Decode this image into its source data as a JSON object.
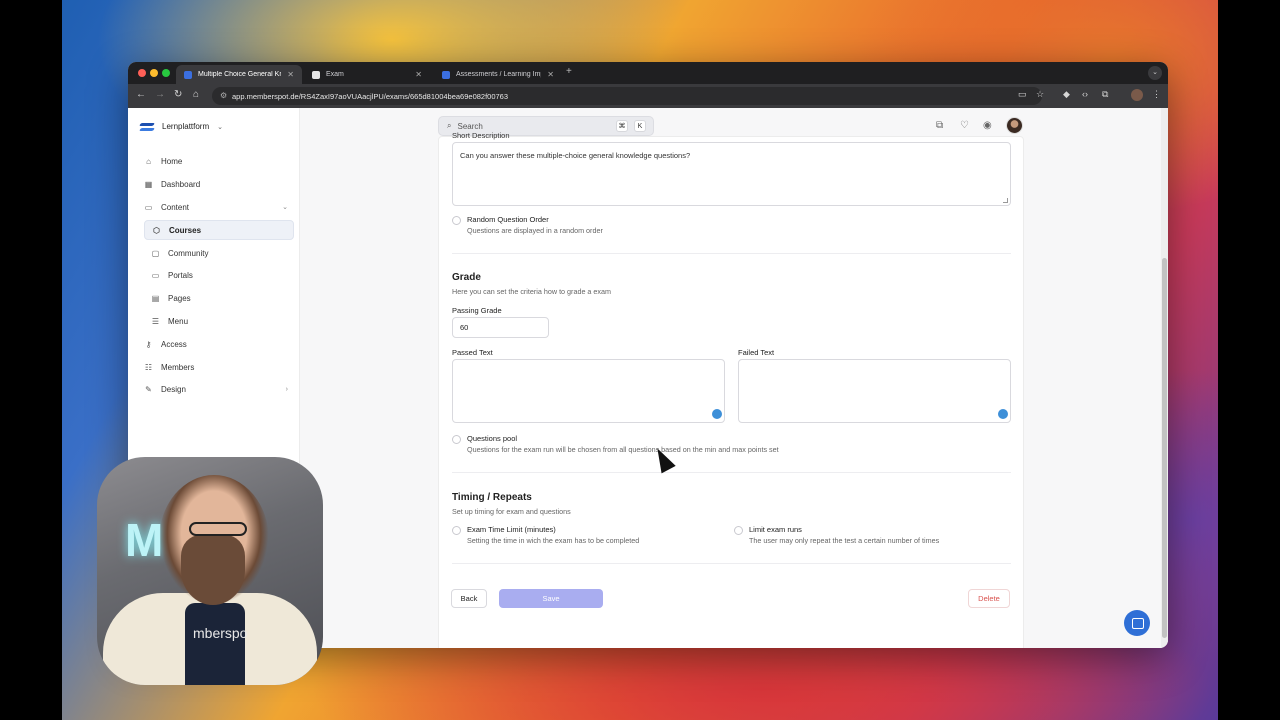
{
  "browser": {
    "tabs": [
      {
        "label": "Multiple Choice General Kno…"
      },
      {
        "label": "Exam"
      },
      {
        "label": "Assessments / Learning Impr…"
      }
    ],
    "url": "app.memberspot.de/RS4ZaxI97aoVUAacjlPU/exams/665d81004bea69e082f00763"
  },
  "sidebar": {
    "brand": "Lernplattform",
    "items": [
      {
        "label": "Home",
        "icon": "home-icon"
      },
      {
        "label": "Dashboard",
        "icon": "dashboard-icon"
      },
      {
        "label": "Content",
        "icon": "folder-icon"
      },
      {
        "label": "Courses",
        "icon": "course-icon"
      },
      {
        "label": "Community",
        "icon": "chat-icon"
      },
      {
        "label": "Portals",
        "icon": "monitor-icon"
      },
      {
        "label": "Pages",
        "icon": "pages-icon"
      },
      {
        "label": "Menu",
        "icon": "menu-icon"
      },
      {
        "label": "Access",
        "icon": "key-icon"
      },
      {
        "label": "Members",
        "icon": "members-icon"
      },
      {
        "label": "Design",
        "icon": "brush-icon"
      }
    ]
  },
  "topbar": {
    "search_placeholder": "Search",
    "shortcut_cmd": "⌘",
    "shortcut_key": "K"
  },
  "form": {
    "short_description_label": "Short Description",
    "short_description_value": "Can you answer these multiple-choice general knowledge questions?",
    "random_order": {
      "title": "Random Question Order",
      "desc": "Questions are displayed in a random order"
    },
    "grade": {
      "title": "Grade",
      "subtitle": "Here you can set the criteria how to grade a exam",
      "passing_label": "Passing Grade",
      "passing_value": "60",
      "passed_text_label": "Passed Text",
      "failed_text_label": "Failed Text"
    },
    "questions_pool": {
      "title": "Questions pool",
      "desc": "Questions for the exam run will be chosen from all questions based on the min and max points set"
    },
    "timing": {
      "title": "Timing / Repeats",
      "subtitle": "Set up timing for exam and questions",
      "time_limit": {
        "title": "Exam Time Limit (minutes)",
        "desc": "Setting the time in wich the exam has to be completed"
      },
      "limit_runs": {
        "title": "Limit exam runs",
        "desc": "The user may only repeat the test a certain number of times"
      }
    },
    "buttons": {
      "back": "Back",
      "save": "Save",
      "delete": "Delete"
    }
  },
  "webcam": {
    "sign": "M",
    "shirt_text": "mberspo"
  },
  "colors": {
    "accent": "#a9adf0",
    "danger": "#d9534f",
    "chat": "#2f6fd6"
  }
}
